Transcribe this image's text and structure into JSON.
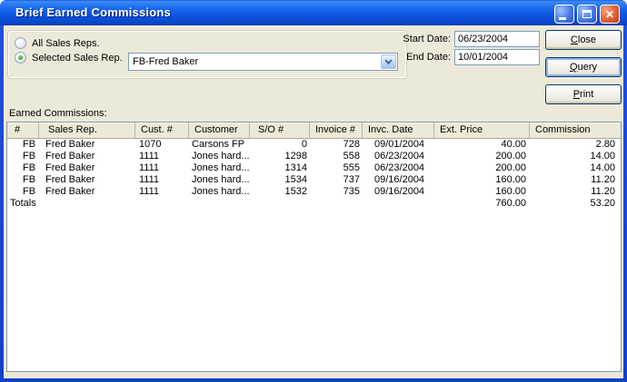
{
  "window": {
    "title": "Brief Earned Commissions"
  },
  "filters": {
    "radio_all": "All Sales Reps.",
    "radio_selected": "Selected Sales Rep.",
    "sales_rep_value": "FB-Fred Baker",
    "start_date_label": "Start Date:",
    "start_date_value": "06/23/2004",
    "end_date_label": "End Date:",
    "end_date_value": "10/01/2004"
  },
  "buttons": {
    "close": "Close",
    "query": "Query",
    "print": "Print"
  },
  "table": {
    "label": "Earned Commissions:",
    "headers": [
      "#",
      "Sales Rep.",
      "Cust. #",
      "Customer",
      "S/O #",
      "Invoice #",
      "Invc. Date",
      "Ext. Price",
      "Commission"
    ],
    "rows": [
      [
        "FB",
        "Fred Baker",
        "1070",
        "Carsons FP",
        "0",
        "728",
        "09/01/2004",
        "40.00",
        "2.80"
      ],
      [
        "FB",
        "Fred Baker",
        "1111",
        "Jones hard...",
        "1298",
        "558",
        "06/23/2004",
        "200.00",
        "14.00"
      ],
      [
        "FB",
        "Fred Baker",
        "1111",
        "Jones hard...",
        "1314",
        "555",
        "06/23/2004",
        "200.00",
        "14.00"
      ],
      [
        "FB",
        "Fred Baker",
        "1111",
        "Jones hard...",
        "1534",
        "737",
        "09/16/2004",
        "160.00",
        "11.20"
      ],
      [
        "FB",
        "Fred Baker",
        "1111",
        "Jones hard...",
        "1532",
        "735",
        "09/16/2004",
        "160.00",
        "11.20"
      ]
    ],
    "totals": {
      "label": "Totals",
      "ext_price": "760.00",
      "commission": "53.20"
    }
  },
  "colors": {
    "titlebar_blue": "#0F57E2",
    "window_frame": "#1544D8",
    "dialog_face": "#ECE9D8",
    "field_border": "#7F9DB9",
    "radio_selected_green": "#23A123",
    "close_button_red": "#DD5C34"
  }
}
